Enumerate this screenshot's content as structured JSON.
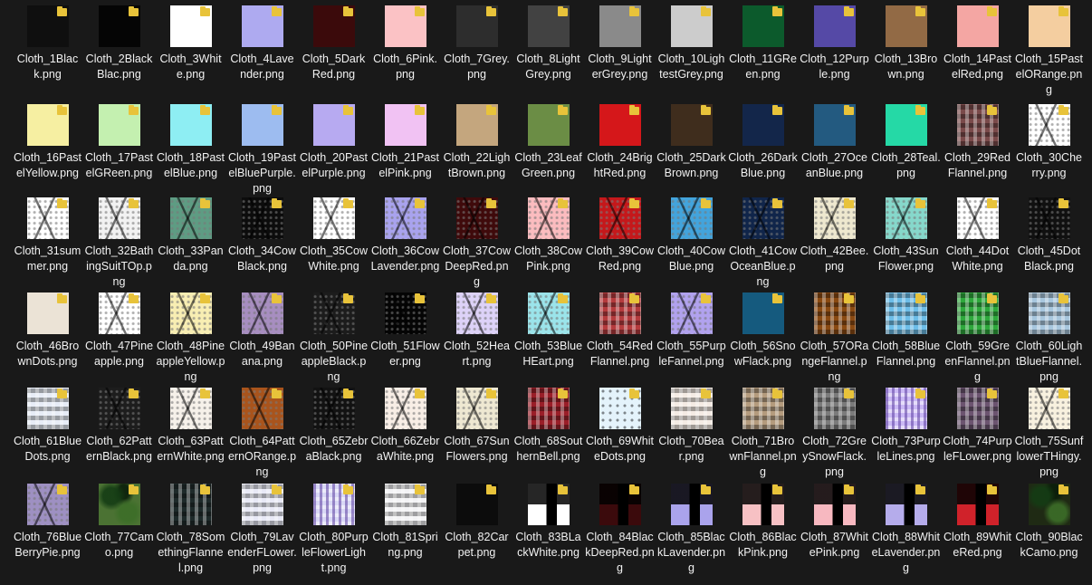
{
  "items": [
    {
      "label": "Cloth_1Black.png",
      "color": "#0f0f0f",
      "pattern": "plain"
    },
    {
      "label": "Cloth_2BlackBlac.png",
      "color": "#050505",
      "pattern": "plain"
    },
    {
      "label": "Cloth_3White.png",
      "color": "#ffffff",
      "pattern": "plain"
    },
    {
      "label": "Cloth_4Lavender.png",
      "color": "#aeaaf0",
      "pattern": "plain"
    },
    {
      "label": "Cloth_5DarkRed.png",
      "color": "#3b0a0b",
      "pattern": "plain"
    },
    {
      "label": "Cloth_6Pink.png",
      "color": "#fbc2c5",
      "pattern": "plain"
    },
    {
      "label": "Cloth_7Grey.png",
      "color": "#2d2d2d",
      "pattern": "plain"
    },
    {
      "label": "Cloth_8LightGrey.png",
      "color": "#424242",
      "pattern": "plain"
    },
    {
      "label": "Cloth_9LighterGrey.png",
      "color": "#8a8a8a",
      "pattern": "plain"
    },
    {
      "label": "Cloth_10LightestGrey.png",
      "color": "#cccccc",
      "pattern": "plain"
    },
    {
      "label": "Cloth_11GReen.png",
      "color": "#0c5a2c",
      "pattern": "plain"
    },
    {
      "label": "Cloth_12Purple.png",
      "color": "#5549a6",
      "pattern": "plain"
    },
    {
      "label": "Cloth_13Brown.png",
      "color": "#926a45",
      "pattern": "plain"
    },
    {
      "label": "Cloth_14PastelRed.png",
      "color": "#f4a6a3",
      "pattern": "plain"
    },
    {
      "label": "Cloth_15PastelORange.png",
      "color": "#f4cea0",
      "pattern": "plain"
    },
    {
      "label": "Cloth_16PastelYellow.png",
      "color": "#f6efa2",
      "pattern": "plain"
    },
    {
      "label": "Cloth_17PastelGReen.png",
      "color": "#c4f0b0",
      "pattern": "plain"
    },
    {
      "label": "Cloth_18PastelBlue.png",
      "color": "#8eeef3",
      "pattern": "plain"
    },
    {
      "label": "Cloth_19PastelBluePurple.png",
      "color": "#9dbcf0",
      "pattern": "plain"
    },
    {
      "label": "Cloth_20PastelPurple.png",
      "color": "#b7aaf1",
      "pattern": "plain"
    },
    {
      "label": "Cloth_21PastelPink.png",
      "color": "#f1c2f3",
      "pattern": "plain"
    },
    {
      "label": "Cloth_22LightBrown.png",
      "color": "#c4a67e",
      "pattern": "plain"
    },
    {
      "label": "Cloth_23LeafGreen.png",
      "color": "#6b8d45",
      "pattern": "plain"
    },
    {
      "label": "Cloth_24BrightRed.png",
      "color": "#d5171a",
      "pattern": "plain"
    },
    {
      "label": "Cloth_25DarkBrown.png",
      "color": "#3f2d1d",
      "pattern": "plain"
    },
    {
      "label": "Cloth_26DarkBlue.png",
      "color": "#13264a",
      "pattern": "plain"
    },
    {
      "label": "Cloth_27OceanBlue.png",
      "color": "#235a80",
      "pattern": "plain"
    },
    {
      "label": "Cloth_28Teal.png",
      "color": "#25d9a6",
      "pattern": "plain"
    },
    {
      "label": "Cloth_29RedFlannel.png",
      "color": "#7a4a4a",
      "pattern": "flannel"
    },
    {
      "label": "Cloth_30Cherry.png",
      "color": "#ffffff",
      "pattern": "earring"
    },
    {
      "label": "Cloth_31summer.png",
      "color": "#ffffff",
      "pattern": "earring"
    },
    {
      "label": "Cloth_32BathingSuitTOp.png",
      "color": "#f2f2f2",
      "pattern": "earring"
    },
    {
      "label": "Cloth_33Panda.png",
      "color": "#5e9c83",
      "pattern": "earring"
    },
    {
      "label": "Cloth_34CowBlack.png",
      "color": "#0c0c0c",
      "pattern": "earring"
    },
    {
      "label": "Cloth_35CowWhite.png",
      "color": "#ffffff",
      "pattern": "earring"
    },
    {
      "label": "Cloth_36CowLavender.png",
      "color": "#a9a3ee",
      "pattern": "earring"
    },
    {
      "label": "Cloth_37CowDeepRed.png",
      "color": "#3f0a0b",
      "pattern": "earring"
    },
    {
      "label": "Cloth_38CowPink.png",
      "color": "#fbbcbf",
      "pattern": "earring"
    },
    {
      "label": "Cloth_39CowRed.png",
      "color": "#c5181b",
      "pattern": "earring"
    },
    {
      "label": "Cloth_40CowBlue.png",
      "color": "#43a4dc",
      "pattern": "earring"
    },
    {
      "label": "Cloth_41CowOceanBlue.png",
      "color": "#10254a",
      "pattern": "earring"
    },
    {
      "label": "Cloth_42Bee.png",
      "color": "#eee8cf",
      "pattern": "earring"
    },
    {
      "label": "Cloth_43SunFlower.png",
      "color": "#86d8cb",
      "pattern": "earring"
    },
    {
      "label": "Cloth_44DotWhite.png",
      "color": "#ffffff",
      "pattern": "earring"
    },
    {
      "label": "Cloth_45DotBlack.png",
      "color": "#101010",
      "pattern": "earring"
    },
    {
      "label": "Cloth_46BrownDots.png",
      "color": "#ebe3d6",
      "pattern": "plain"
    },
    {
      "label": "Cloth_47Pineapple.png",
      "color": "#ffffff",
      "pattern": "earring"
    },
    {
      "label": "Cloth_48PineappleYellow.png",
      "color": "#f8eeb3",
      "pattern": "earring"
    },
    {
      "label": "Cloth_49Banana.png",
      "color": "#a78ec0",
      "pattern": "earring"
    },
    {
      "label": "Cloth_50PineappleBlack.png",
      "color": "#1c1c1c",
      "pattern": "earring"
    },
    {
      "label": "Cloth_51Flower.png",
      "color": "#050505",
      "pattern": "earring"
    },
    {
      "label": "Cloth_52Heart.png",
      "color": "#ddd2f8",
      "pattern": "earring"
    },
    {
      "label": "Cloth_53BlueHEart.png",
      "color": "#9be4ea",
      "pattern": "earring"
    },
    {
      "label": "Cloth_54RedFlannel.png",
      "color": "#b53b3d",
      "pattern": "flannel"
    },
    {
      "label": "Cloth_55PurpleFannel.png",
      "color": "#b1a2ee",
      "pattern": "earring"
    },
    {
      "label": "Cloth_56SnowFlack.png",
      "color": "#155a7e",
      "pattern": "plain"
    },
    {
      "label": "Cloth_57ORangeFlannel.png",
      "color": "#8a4a12",
      "pattern": "flannel"
    },
    {
      "label": "Cloth_58BlueFlannel.png",
      "color": "#6dbde8",
      "pattern": "flannel"
    },
    {
      "label": "Cloth_59GreenFlannel.png",
      "color": "#2ea83c",
      "pattern": "flannel"
    },
    {
      "label": "Cloth_60LightBlueFlannel.png",
      "color": "#a7c6dd",
      "pattern": "flannel"
    },
    {
      "label": "Cloth_61BlueDots.png",
      "color": "#e7ecf6",
      "pattern": "flannel"
    },
    {
      "label": "Cloth_62PatternBlack.png",
      "color": "#1d1d1d",
      "pattern": "earring"
    },
    {
      "label": "Cloth_63PatternWhite.png",
      "color": "#f6f1ea",
      "pattern": "earring"
    },
    {
      "label": "Cloth_64PatternORange.png",
      "color": "#a9541c",
      "pattern": "earring"
    },
    {
      "label": "Cloth_65ZebraBlack.png",
      "color": "#121212",
      "pattern": "earring"
    },
    {
      "label": "Cloth_66ZebraWhite.png",
      "color": "#f8eee6",
      "pattern": "earring"
    },
    {
      "label": "Cloth_67SunFlowers.png",
      "color": "#eee8d2",
      "pattern": "earring"
    },
    {
      "label": "Cloth_68SouthernBell.png",
      "color": "#9a1e28",
      "pattern": "flannel"
    },
    {
      "label": "Cloth_69WhiteDots.png",
      "color": "#e4f3fb",
      "pattern": "dots"
    },
    {
      "label": "Cloth_70Bear.png",
      "color": "#f4ebe4",
      "pattern": "flannel"
    },
    {
      "label": "Cloth_71BrownFlannel.png",
      "color": "#b49b7d",
      "pattern": "flannel"
    },
    {
      "label": "Cloth_72GreySnowFlack.png",
      "color": "#7b7b7b",
      "pattern": "flannel"
    },
    {
      "label": "Cloth_73PurpleLines.png",
      "color": "#cbb9f5",
      "pattern": "lines"
    },
    {
      "label": "Cloth_74PurpleFLower.png",
      "color": "#6c5470",
      "pattern": "flannel"
    },
    {
      "label": "Cloth_75SunflowerTHingy.png",
      "color": "#f8f1df",
      "pattern": "earring"
    },
    {
      "label": "Cloth_76BlueBerryPie.png",
      "color": "#9e90c2",
      "pattern": "earring"
    },
    {
      "label": "Cloth_77Camo.png",
      "color": "#4b7233",
      "pattern": "camo"
    },
    {
      "label": "Cloth_78SomethingFlannel.png",
      "color": "#1e2a2a",
      "pattern": "flannel"
    },
    {
      "label": "Cloth_79LavenderFLower.png",
      "color": "#e8e9f6",
      "pattern": "flannel"
    },
    {
      "label": "Cloth_80PurpleFlowerLight.png",
      "color": "#d9d8f5",
      "pattern": "lines"
    },
    {
      "label": "Cloth_81Spring.png",
      "color": "#f3f3f5",
      "pattern": "flannel"
    },
    {
      "label": "Cloth_82Carpet.png",
      "color": "#0c0c0c",
      "pattern": "plain"
    },
    {
      "label": "Cloth_83BLackWhite.png",
      "color": "#ffffff",
      "pattern": "block"
    },
    {
      "label": "Cloth_84BlackDeepRed.png",
      "color": "#3b0a0c",
      "pattern": "block"
    },
    {
      "label": "Cloth_85BlackLavender.png",
      "color": "#aaa3ec",
      "pattern": "block"
    },
    {
      "label": "Cloth_86BlackPink.png",
      "color": "#f7c1c4",
      "pattern": "block"
    },
    {
      "label": "Cloth_87WhitePink.png",
      "color": "#f7b8c0",
      "pattern": "block"
    },
    {
      "label": "Cloth_88WhiteLavender.png",
      "color": "#b5aceb",
      "pattern": "block"
    },
    {
      "label": "Cloth_89WhiteRed.png",
      "color": "#d0222a",
      "pattern": "block"
    },
    {
      "label": "Cloth_90BlackCamo.png",
      "color": "#1f2a14",
      "pattern": "camo"
    }
  ]
}
